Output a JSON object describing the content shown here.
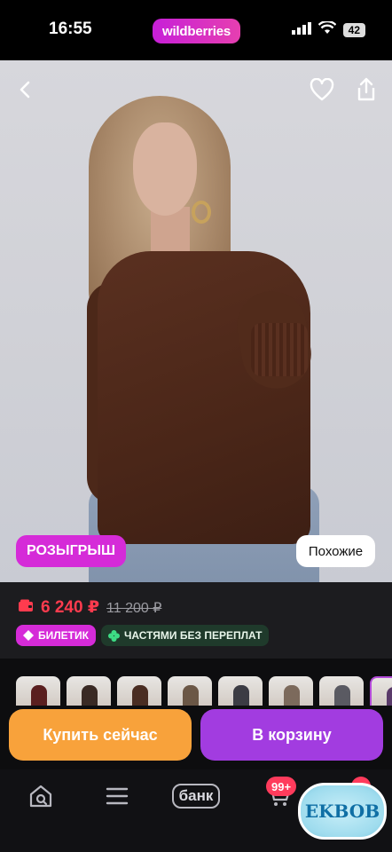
{
  "status_bar": {
    "time": "16:55",
    "brand": "wildberries",
    "battery": "42"
  },
  "product": {
    "promo_tag": "РОЗЫГРЫШ",
    "similar_label": "Похожие",
    "price": "6 240 ₽",
    "old_price": "11 200 ₽",
    "badges": [
      "БИЛЕТИК",
      "ЧАСТЯМИ БЕЗ ПЕРЕПЛАТ"
    ]
  },
  "thumbnails": [
    {
      "color": "#5a1f1f"
    },
    {
      "color": "#3a2a24"
    },
    {
      "color": "#4a2d22"
    },
    {
      "color": "#6b5746"
    },
    {
      "color": "#3c3c44"
    },
    {
      "color": "#7c6a5c"
    },
    {
      "color": "#5a5a62"
    },
    {
      "color": "#5a3a6a"
    }
  ],
  "actions": {
    "buy_now": "Купить сейчас",
    "add_to_cart": "В корзину"
  },
  "tabbar": {
    "bank_label": "банк",
    "cart_count": "99+",
    "profile_count": "3"
  },
  "watermark": "EKBOB",
  "colors": {
    "accent_purple": "#a23ce0",
    "accent_orange": "#f8a23b",
    "price_red": "#ff3b4e"
  }
}
